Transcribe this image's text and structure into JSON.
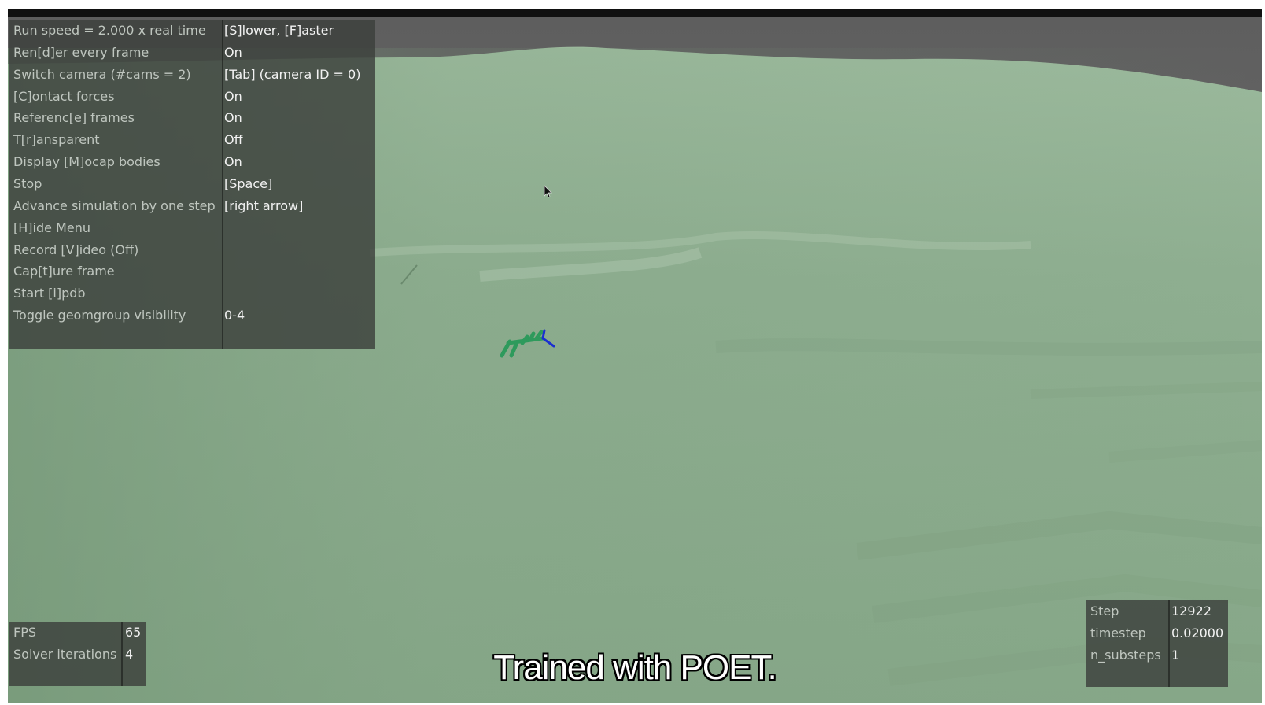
{
  "menu": {
    "rows": [
      {
        "label": "Run speed = 2.000 x real time",
        "value": "[S]lower, [F]aster"
      },
      {
        "label": "Ren[d]er every frame",
        "value": "On"
      },
      {
        "label": "Switch camera (#cams = 2)",
        "value": "[Tab] (camera ID = 0)"
      },
      {
        "label": "[C]ontact forces",
        "value": "On"
      },
      {
        "label": "Referenc[e] frames",
        "value": "On"
      },
      {
        "label": "T[r]ansparent",
        "value": "Off"
      },
      {
        "label": "Display [M]ocap bodies",
        "value": "On"
      },
      {
        "label": "Stop",
        "value": "[Space]"
      },
      {
        "label": "Advance simulation by one step",
        "value": "[right arrow]"
      },
      {
        "label": "[H]ide Menu",
        "value": ""
      },
      {
        "label": "Record [V]ideo (Off)",
        "value": ""
      },
      {
        "label": "Cap[t]ure frame",
        "value": ""
      },
      {
        "label": "Start [i]pdb",
        "value": ""
      },
      {
        "label": "Toggle geomgroup visibility",
        "value": "0-4"
      }
    ]
  },
  "perf": {
    "rows": [
      {
        "label": "FPS",
        "value": "65"
      },
      {
        "label": "Solver iterations",
        "value": "4"
      }
    ]
  },
  "sim_stats": {
    "rows": [
      {
        "label": "Step",
        "value": "12922"
      },
      {
        "label": "timestep",
        "value": "0.02000"
      },
      {
        "label": "n_substeps",
        "value": "1"
      }
    ]
  },
  "caption": "Trained with POET.",
  "colors": {
    "terrain": "#8fae91",
    "sky": "#6e6e6e",
    "robot_body": "#2e9a5c",
    "robot_frame": "#1a2fd0",
    "panel_bg": "#3c403c"
  },
  "icons": {
    "cursor": "mouse-pointer-icon",
    "agent": "quadruped-robot"
  }
}
